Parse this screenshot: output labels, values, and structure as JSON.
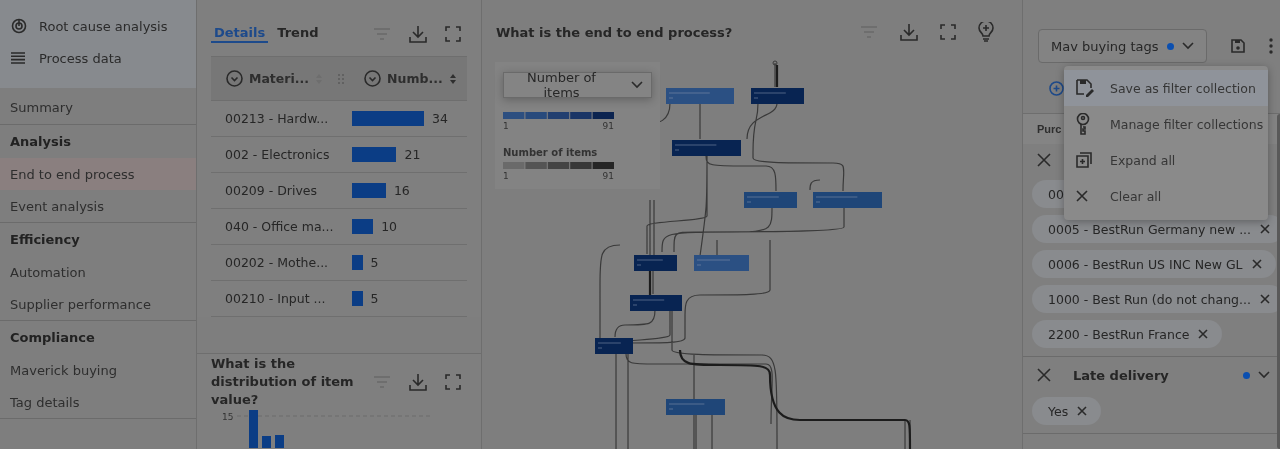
{
  "sidebar": {
    "top_items": [
      {
        "label": "Root cause analysis"
      },
      {
        "label": "Process data"
      }
    ],
    "groups": [
      {
        "items": [
          {
            "label": "Summary",
            "selected": false
          }
        ]
      },
      {
        "heading": "Analysis",
        "items": [
          {
            "label": "End to end process",
            "selected": true
          },
          {
            "label": "Event analysis",
            "selected": false
          }
        ]
      },
      {
        "heading": "Efficiency",
        "items": [
          {
            "label": "Automation",
            "selected": false
          },
          {
            "label": "Supplier performance",
            "selected": false
          }
        ]
      },
      {
        "heading": "Compliance",
        "items": [
          {
            "label": "Maverick buying",
            "selected": false
          },
          {
            "label": "Tag details",
            "selected": false
          }
        ]
      }
    ]
  },
  "details_panel": {
    "tabs": [
      {
        "label": "Details",
        "selected": true
      },
      {
        "label": "Trend",
        "selected": false
      }
    ],
    "columns": [
      {
        "label": "Materi..."
      },
      {
        "label": "Numb..."
      }
    ],
    "rows": [
      {
        "material": "00213 - Hardw...",
        "count": "34"
      },
      {
        "material": "002 - Electronics",
        "count": "21"
      },
      {
        "material": "00209 - Drives",
        "count": "16"
      },
      {
        "material": "040 - Office ma...",
        "count": "10"
      },
      {
        "material": "00202 - Mothe...",
        "count": "5"
      },
      {
        "material": "00210 - Input ...",
        "count": "5"
      }
    ]
  },
  "distribution_panel": {
    "title": "What is the distribution of item value?",
    "y_tick": "15"
  },
  "process_panel": {
    "title": "What is the end to end process?",
    "measure": "Number of items",
    "legends": [
      {
        "kind": "blue",
        "min": "1",
        "max": "91"
      },
      {
        "kind": "grey",
        "title": "Number of items",
        "min": "1",
        "max": "91"
      }
    ]
  },
  "filter_panel": {
    "collection": {
      "value": "Mav buying tags",
      "modified": true
    },
    "group_label": "Purc",
    "filters": [
      {
        "chips": [
          "00",
          "0005 - BestRun Germany new ...",
          "0006 - BestRun US INC New GL",
          "1000 - Best Run (do not chang...",
          "2200 - BestRun France"
        ]
      },
      {
        "title": "Late delivery",
        "modified": true,
        "chips": [
          "Yes"
        ]
      }
    ],
    "menu": [
      {
        "label": "Save as filter collection",
        "selected": true
      },
      {
        "label": "Manage filter collections",
        "selected": false
      },
      {
        "label": "Expand all",
        "selected": false
      },
      {
        "label": "Clear all",
        "selected": false
      }
    ]
  }
}
